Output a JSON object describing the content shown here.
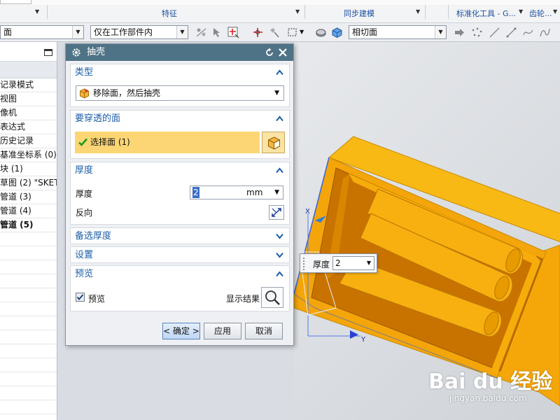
{
  "ribbon": {
    "groups": [
      "特征",
      "同步建模",
      "标准化工具 - G...",
      "齿轮..."
    ]
  },
  "toolbar": {
    "combo_left_value": "面",
    "combo_scope_value": "仅在工作部件内",
    "combo_face_rule_value": "相切面"
  },
  "navigator": {
    "rows": [
      {
        "label": "记录模式"
      },
      {
        "label": "视图"
      },
      {
        "label": "像机"
      },
      {
        "label": "表达式"
      },
      {
        "label": "历史记录"
      },
      {
        "label": "基准坐标系 (0)"
      },
      {
        "label": "块 (1)"
      },
      {
        "label": "草图 (2) \"SKET"
      },
      {
        "label": "管道 (3)"
      },
      {
        "label": "管道 (4)"
      },
      {
        "label": "管道 (5)"
      }
    ]
  },
  "dialog": {
    "title": "抽壳",
    "sections": {
      "type": {
        "header": "类型",
        "value": "移除面，然后抽壳"
      },
      "faces": {
        "header": "要穿透的面",
        "select_label": "选择面 (1)"
      },
      "thickness": {
        "header": "厚度",
        "label": "厚度",
        "value": "2",
        "unit": "mm",
        "reverse_label": "反向"
      },
      "alt_thickness": {
        "header": "备选厚度"
      },
      "settings": {
        "header": "设置"
      },
      "preview": {
        "header": "预览",
        "checkbox_label": "预览",
        "show_result_label": "显示结果"
      }
    },
    "buttons": {
      "ok": "< 确定 >",
      "apply": "应用",
      "cancel": "取消"
    }
  },
  "viewport": {
    "thickness_popup": {
      "label": "厚度",
      "value": "2"
    },
    "axis_labels": {
      "x": "X",
      "y": "Y"
    },
    "watermark": "Bai du 经验",
    "watermark_sub": "jingyan.baidu.com"
  },
  "colors": {
    "dialog_title_bg": "#4f7386",
    "section_header_text": "#1c5ea9",
    "selected_row_bg": "#fcd675",
    "part_orange": "#f6ad0b"
  }
}
